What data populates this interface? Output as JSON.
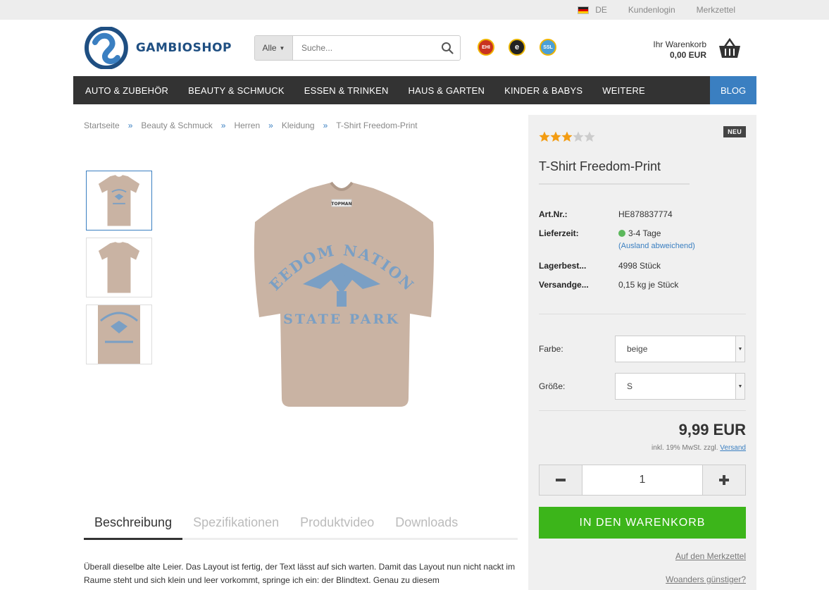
{
  "topbar": {
    "language": "DE",
    "login": "Kundenlogin",
    "wishlist": "Merkzettel"
  },
  "header": {
    "logo_text": "GAMBIOSHOP",
    "search": {
      "category": "Alle",
      "placeholder": "Suche..."
    },
    "badges": [
      "EHI",
      "e",
      "SSL"
    ],
    "cart": {
      "label": "Ihr Warenkorb",
      "total": "0,00 EUR"
    }
  },
  "nav": {
    "items": [
      {
        "label": "AUTO & ZUBEHÖR"
      },
      {
        "label": "BEAUTY & SCHMUCK"
      },
      {
        "label": "ESSEN & TRINKEN"
      },
      {
        "label": "HAUS & GARTEN"
      },
      {
        "label": "KINDER & BABYS"
      },
      {
        "label": "WEITERE"
      }
    ],
    "blog": "BLOG"
  },
  "breadcrumb": {
    "items": [
      "Startseite",
      "Beauty & Schmuck",
      "Herren",
      "Kleidung",
      "T-Shirt Freedom-Print"
    ],
    "separator": "»"
  },
  "product": {
    "shirt_print_top": "FREEDOM NATIONAL",
    "shirt_print_bottom": "STATE PARK",
    "shirt_tag": "TOPMAN",
    "badge": "NEU",
    "rating": 3.5,
    "rating_max": 5,
    "title": "T-Shirt Freedom-Print",
    "specs": {
      "art_label": "Art.Nr.:",
      "art_value": "HE878837774",
      "delivery_label": "Lieferzeit:",
      "delivery_value": "3-4 Tage",
      "delivery_note": "(Ausland abweichend)",
      "stock_label": "Lagerbest...",
      "stock_value": "4998 Stück",
      "weight_label": "Versandge...",
      "weight_value": "0,15 kg je Stück"
    },
    "options": {
      "color_label": "Farbe:",
      "color_value": "beige",
      "size_label": "Größe:",
      "size_value": "S"
    },
    "price": "9,99 EUR",
    "tax_text": "inkl. 19% MwSt. zzgl.",
    "shipping_link": "Versand",
    "quantity": "1",
    "add_to_cart": "IN DEN WARENKORB",
    "wishlist_link": "Auf den Merkzettel",
    "cheaper_link": "Woanders günstiger?"
  },
  "tabs": [
    {
      "label": "Beschreibung"
    },
    {
      "label": "Spezifikationen"
    },
    {
      "label": "Produktvideo"
    },
    {
      "label": "Downloads"
    }
  ],
  "description": "Überall dieselbe alte Leier. Das Layout ist fertig, der Text lässt auf sich warten. Damit das Layout nun nicht nackt im Raume steht und sich klein und leer vorkommt, springe ich ein: der Blindtext. Genau zu diesem",
  "colors": {
    "nav_bg": "#333333",
    "blog_bg": "#3a7fc1",
    "cart_button": "#3cb51a",
    "panel_bg": "#f0f0f0",
    "star": "#f39c12",
    "shirt": "#c9b3a3",
    "print": "#7a9fc4"
  }
}
